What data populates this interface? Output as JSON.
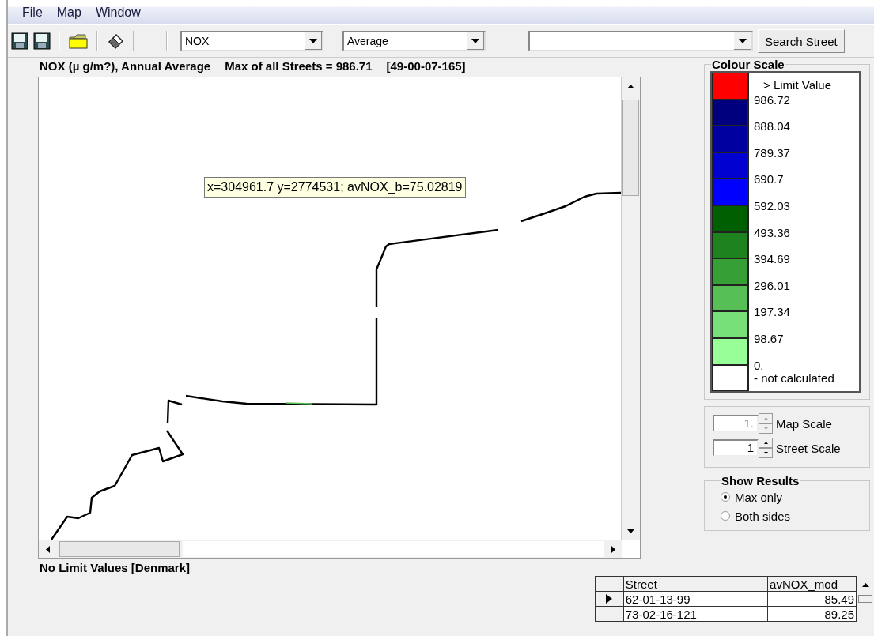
{
  "menu": [
    "File",
    "Map",
    "Window"
  ],
  "toolbar": {
    "pollutant": "NOX",
    "statistic": "Average",
    "search_button": "Search Street"
  },
  "map": {
    "title": "NOX (µ g/m?), Annual Average",
    "max": "Max of all Streets = 986.71",
    "max_street": "[49-00-07-165]",
    "tooltip": "x=304961.7 y=2774531; avNOX_b=75.02819",
    "footnote": "No Limit Values [Denmark]"
  },
  "colour_scale": {
    "title": "Colour Scale",
    "entries": [
      {
        "color": "#ff0000",
        "label": "> Limit Value"
      },
      {
        "color": "#00007f",
        "label": "986.72"
      },
      {
        "color": "#0000a0",
        "label": "888.04"
      },
      {
        "color": "#0000d0",
        "label": "789.37"
      },
      {
        "color": "#0000ff",
        "label": "690.7"
      },
      {
        "color": "#005f00",
        "label": "592.03"
      },
      {
        "color": "#1e821e",
        "label": "493.36"
      },
      {
        "color": "#36a036",
        "label": "394.69"
      },
      {
        "color": "#56c056",
        "label": "296.01"
      },
      {
        "color": "#78e078",
        "label": "197.34"
      },
      {
        "color": "#98ff98",
        "label": "98.67"
      },
      {
        "color": "#ffffff",
        "label": "0."
      }
    ],
    "note": "- not calculated"
  },
  "scales": [
    {
      "label": "Map Scale",
      "value": "1.",
      "disabled": true
    },
    {
      "label": "Street Scale",
      "value": "1",
      "disabled": false
    }
  ],
  "show_results": {
    "title": "Show Results",
    "options": [
      {
        "label": "Max only",
        "selected": true
      },
      {
        "label": "Both sides",
        "selected": false
      }
    ]
  },
  "street_table": {
    "columns": [
      "Street",
      "avNOX_mod"
    ],
    "rows": [
      {
        "street": "62-01-13-99",
        "value": "85.49",
        "current": true
      },
      {
        "street": "73-02-16-121",
        "value": "89.25",
        "current": false
      }
    ]
  }
}
